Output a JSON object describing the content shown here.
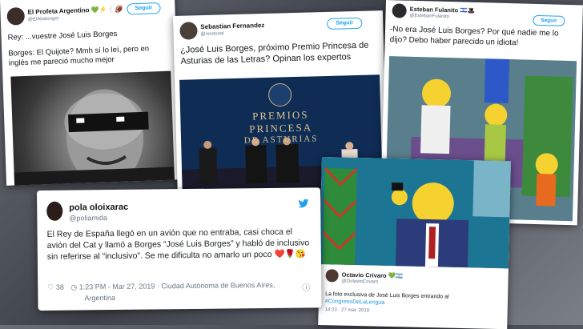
{
  "tweets": {
    "profeta": {
      "name": "El Profeta Argentino",
      "name_emoji": "💚⚡❕🏈",
      "handle": "@ElAbalonger",
      "follow": "Seguir",
      "line1": "Rey: ...vuestre José Luis Borges",
      "line2": "Borges: El Quijote? Mmh sí lo leí, pero en inglés me pareció mucho mejor"
    },
    "sebastian": {
      "name": "Sebastian Fernandez",
      "handle": "@nnotonel",
      "follow": "Seguir",
      "text": "¿José Luis Borges, próximo Premio Princesa de Asturias de las Letras? Opinan los expertos",
      "banner1": "PREMIOS",
      "banner2": "PRINCESA",
      "banner3": "DE ASTURIAS"
    },
    "esteban": {
      "name": "Esteban Fulanito",
      "name_emoji": "🇮🇱🎩",
      "handle": "@EstebanFulanito",
      "follow": "Seguir",
      "text": "-No era José Luis Borges? Por qué nadie me lo dijo? Debo haber parecido un idiota!"
    },
    "pola": {
      "name": "pola oloixarac",
      "handle": "@poliamida",
      "text": "El Rey de España llegó en un avión que no entraba, casi choca el avión del Cat y llamó a Borges “José Luis Borges” y habló de inclusivo sin referirse al “inclusivo”. Se me dificulta no amarlo un poco ❤️🌹😘",
      "likes": "38",
      "time": "1:23 PM - Mar 27, 2019 · Ciudad Autónoma de Buenos Aires,",
      "place": "Argentina",
      "colors": {
        "twitter": "#1da1f2",
        "heart": "#e0245e"
      }
    },
    "octavio": {
      "name": "Octavio Crivaro",
      "name_emoji": "💚🇦🇷",
      "handle": "@OctavioCrivaro",
      "text": "La foto exclusiva de José Luis Borges entrando al",
      "hashtag": "#CongresoDeLaLengua",
      "time": "14:23 · 27 mar. 2019"
    }
  }
}
